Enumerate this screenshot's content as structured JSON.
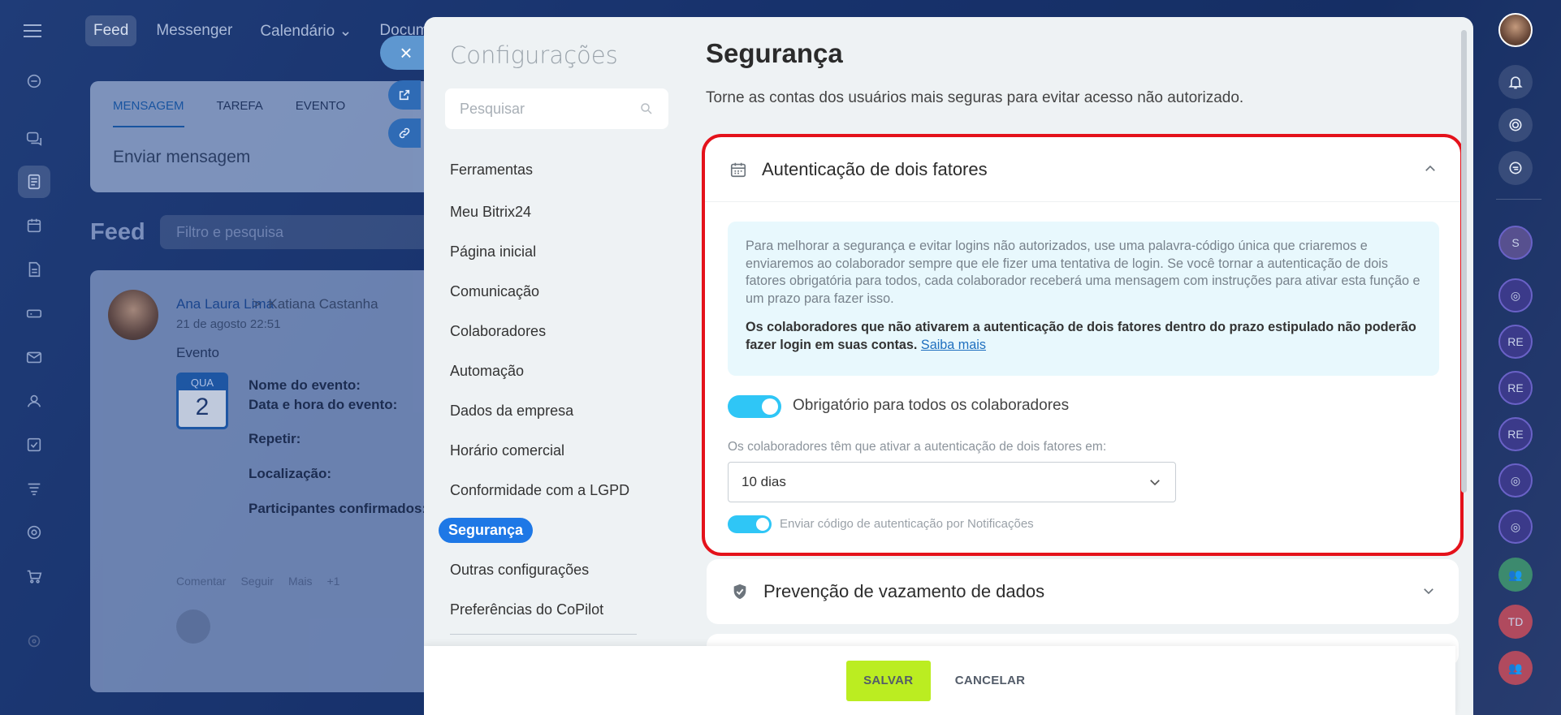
{
  "background": {
    "top_nav": [
      "Feed",
      "Messenger",
      "Calendário ⌄",
      "Docume"
    ],
    "composer": {
      "tabs": [
        "MENSAGEM",
        "TAREFA",
        "EVENTO"
      ],
      "placeholder": "Enviar mensagem"
    },
    "feed": {
      "title": "Feed",
      "search_placeholder": "Filtro e pesquisa"
    },
    "post": {
      "author": "Ana Laura Lima",
      "recipient": "Katiana Castanha",
      "date": "21 de agosto 22:51",
      "type": "Evento",
      "calendar_day_name": "QUA",
      "calendar_day": "2",
      "fields": [
        "Nome do evento:",
        "Data e hora do evento:",
        "Repetir:",
        "Localização:",
        "Participantes confirmados:"
      ],
      "actions": [
        "Comentar",
        "Seguir",
        "Mais",
        "+1"
      ]
    },
    "right_panel_avatars": [
      "S",
      "RE",
      "RE",
      "RE",
      "TD"
    ]
  },
  "settings": {
    "menu_title": "Configurações",
    "search_placeholder": "Pesquisar",
    "menu_items": [
      "Ferramentas",
      "Meu Bitrix24",
      "Página inicial",
      "Comunicação",
      "Colaboradores",
      "Automação",
      "Dados da empresa",
      "Horário comercial",
      "Conformidade com a LGPD",
      "Segurança",
      "Outras configurações",
      "Preferências do CoPilot"
    ],
    "active_item": "Segurança",
    "page_title": "Segurança",
    "page_subtitle": "Torne as contas dos usuários mais seguras para evitar acesso não autorizado.",
    "two_factor": {
      "title": "Autenticação de dois fatores",
      "info_text": "Para melhorar a segurança e evitar logins não autorizados, use uma palavra-código única que criaremos e enviaremos ao colaborador sempre que ele fizer uma tentativa de login. Se você tornar a autenticação de dois fatores obrigatória para todos, cada colaborador receberá uma mensagem com instruções para ativar esta função e um prazo para fazer isso.",
      "warning_text": "Os colaboradores que não ativarem a autenticação de dois fatores dentro do prazo estipulado não poderão fazer login em suas contas.",
      "learn_more": "Saiba mais",
      "mandatory_toggle_label": "Obrigatório para todos os colaboradores",
      "mandatory_toggle_on": true,
      "deadline_label": "Os colaboradores têm que ativar a autenticação de dois fatores em:",
      "deadline_value": "10 dias",
      "notify_toggle_label": "Enviar código de autenticação por Notificações",
      "notify_toggle_on": true
    },
    "data_leak": {
      "title": "Prevenção de vazamento de dados"
    },
    "footer": {
      "save": "SALVAR",
      "cancel": "CANCELAR"
    }
  },
  "colors": {
    "accent_blue": "#1e78e6",
    "toggle_on": "#2fc6f6",
    "save_button": "#bbed21",
    "highlight_border": "#e4121b",
    "info_bg": "#e8f8fd"
  }
}
